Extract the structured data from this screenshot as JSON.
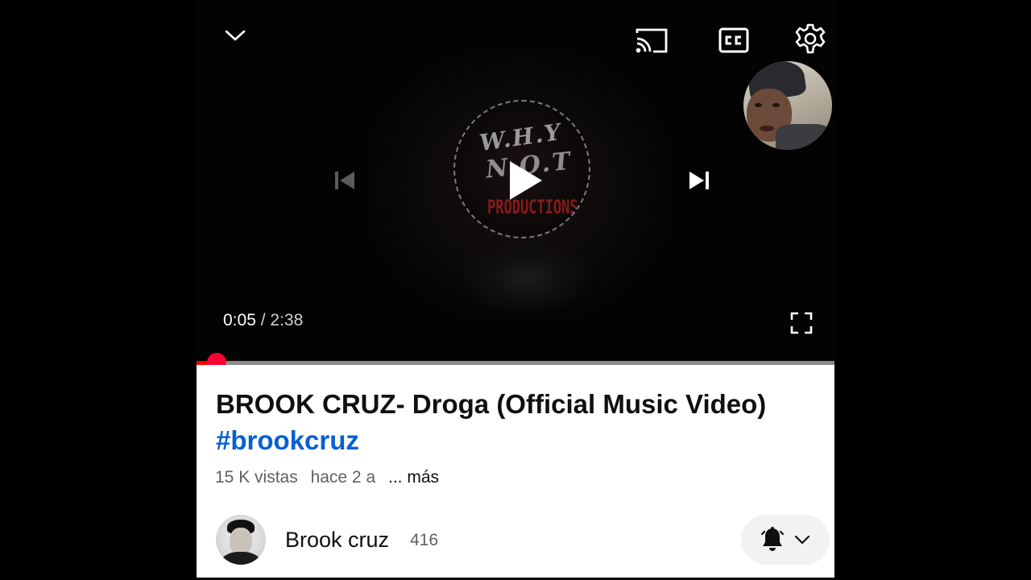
{
  "player": {
    "logo_lines": [
      "W.H.Y",
      "N.O.T",
      "PRODUCTIONS"
    ],
    "current_time": "0:05",
    "separator": " / ",
    "duration": "2:38",
    "progress_fraction": 0.032,
    "icons": {
      "collapse": "chevron-down-icon",
      "cast": "cast-icon",
      "captions": "cc-icon",
      "settings": "gear-icon",
      "previous": "skip-previous-icon",
      "play": "play-icon",
      "next": "skip-next-icon",
      "fullscreen": "fullscreen-icon"
    },
    "accent_color": "#ff0000"
  },
  "video": {
    "title": "BROOK CRUZ- Droga (Official Music Video)",
    "hashtag": "#brookcruz",
    "views": "15 K vistas",
    "age": "hace 2 a",
    "more": "... más"
  },
  "channel": {
    "name": "Brook cruz",
    "subscribers": "416",
    "icons": {
      "bell": "bell-icon",
      "dropdown": "chevron-down-icon"
    }
  }
}
